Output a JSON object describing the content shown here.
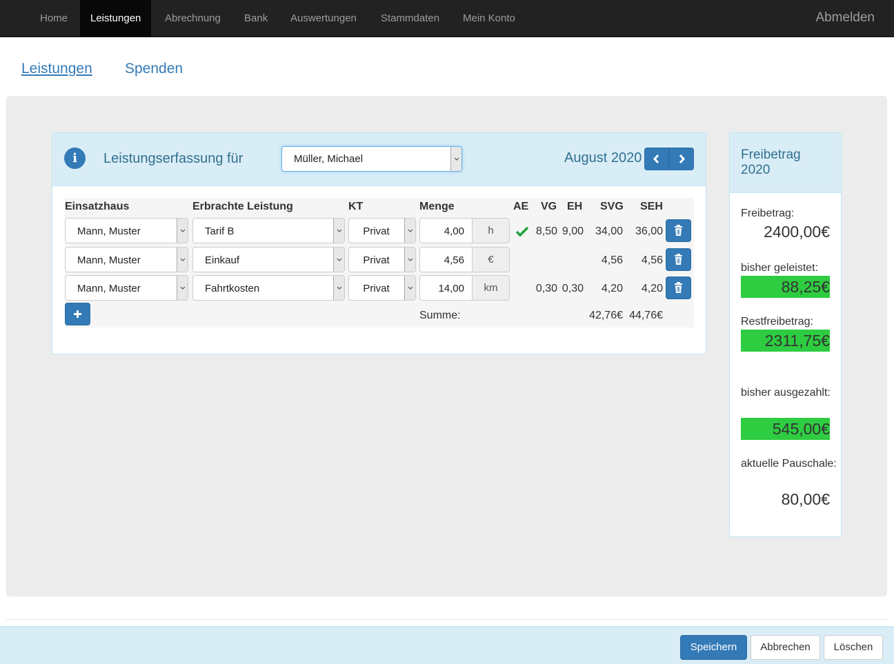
{
  "nav": {
    "items": [
      "Home",
      "Leistungen",
      "Abrechnung",
      "Bank",
      "Auswertungen",
      "Stammdaten",
      "Mein Konto"
    ],
    "active": "Leistungen",
    "logout": "Abmelden"
  },
  "subtabs": [
    "Leistungen",
    "Spenden"
  ],
  "panel": {
    "title": "Leistungserfassung für",
    "person": "Müller, Michael",
    "month": "August 2020"
  },
  "table": {
    "headers": [
      "Einsatzhaus",
      "Erbrachte Leistung",
      "KT",
      "Menge",
      "AE",
      "VG",
      "EH",
      "SVG",
      "SEH"
    ],
    "rows": [
      {
        "einsatzhaus": "Mann, Muster",
        "leistung": "Tarif B",
        "kt": "Privat",
        "menge": "4,00",
        "unit": "h",
        "ae": true,
        "vg": "8,50",
        "eh": "9,00",
        "svg": "34,00",
        "seh": "36,00"
      },
      {
        "einsatzhaus": "Mann, Muster",
        "leistung": "Einkauf",
        "kt": "Privat",
        "menge": "4,56",
        "unit": "€",
        "ae": false,
        "vg": "",
        "eh": "",
        "svg": "4,56",
        "seh": "4,56"
      },
      {
        "einsatzhaus": "Mann, Muster",
        "leistung": "Fahrtkosten",
        "kt": "Privat",
        "menge": "14,00",
        "unit": "km",
        "ae": false,
        "vg": "0,30",
        "eh": "0,30",
        "svg": "4,20",
        "seh": "4,20"
      }
    ],
    "sum_label": "Summe:",
    "sum_svg": "42,76€",
    "sum_seh": "44,76€"
  },
  "side": {
    "title": "Freibetrag 2020",
    "freibetrag_label": "Freibetrag:",
    "freibetrag_value": "2400,00€",
    "geleistet_label": "bisher geleistet:",
    "geleistet_value": "88,25€",
    "rest_label": "Restfreibetrag:",
    "rest_value": "2311,75€",
    "ausgezahlt_label": "bisher ausgezahlt:",
    "ausgezahlt_value": "545,00€",
    "pauschale_label": "aktuelle Pauschale:",
    "pauschale_value": "80,00€",
    "highlight_color": "#2ecc40"
  },
  "footer": {
    "save": "Speichern",
    "cancel": "Abbrechen",
    "delete": "Löschen"
  }
}
